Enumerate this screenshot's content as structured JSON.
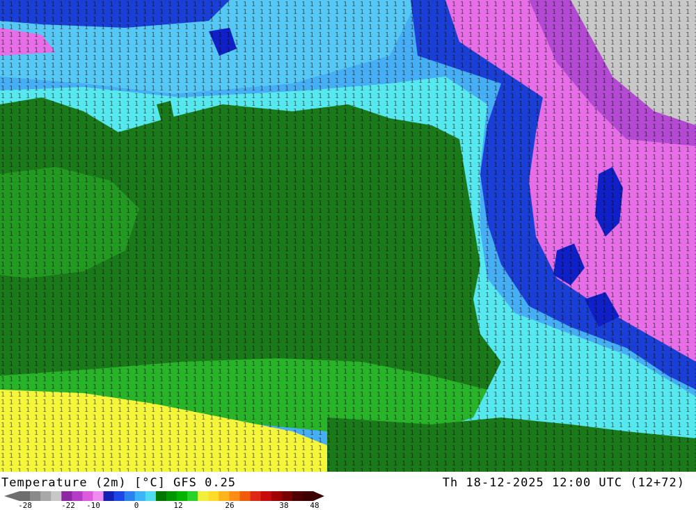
{
  "map": {
    "kind": "gridded temperature field over sea and land",
    "colors": {
      "deep_sea": "#1a3fd6",
      "sea_light": "#46aef5",
      "cyan": "#55e8ee",
      "land_green": "#1a7a1a",
      "bright_green": "#28b428",
      "yellow": "#f5f53a",
      "magenta": "#e86ee8",
      "purple": "#b44ad4",
      "gray": "#c8c8c8",
      "navy": "#1020c8"
    }
  },
  "footer": {
    "title": "Temperature (2m) [°C] GFS 0.25",
    "valid": "Th 18-12-2025 12:00 UTC (12+72)",
    "scale_ticks": [
      "-28",
      "-22",
      "-10",
      "0",
      "12",
      "26",
      "38",
      "48"
    ],
    "scale_colors": [
      "#6e6e6e",
      "#8a8a8a",
      "#a8a8a8",
      "#c8c8c8",
      "#8c28a0",
      "#b43cc8",
      "#dc5adc",
      "#f08cf0",
      "#1420b4",
      "#1e46e6",
      "#2a82f0",
      "#3cb4f8",
      "#50dcf0",
      "#007800",
      "#009600",
      "#00b400",
      "#28d228",
      "#f0f03c",
      "#ffdc28",
      "#ffb41e",
      "#ff8c14",
      "#f05a0a",
      "#dc2814",
      "#c80a0a",
      "#a00000",
      "#780000",
      "#500000",
      "#3c0000"
    ]
  }
}
